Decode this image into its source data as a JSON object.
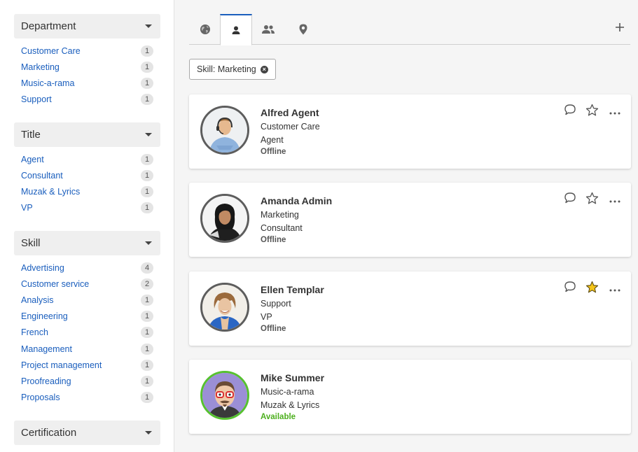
{
  "sidebar": {
    "facets": [
      {
        "title": "Department",
        "items": [
          {
            "label": "Customer Care",
            "count": "1"
          },
          {
            "label": "Marketing",
            "count": "1"
          },
          {
            "label": "Music-a-rama",
            "count": "1"
          },
          {
            "label": "Support",
            "count": "1"
          }
        ]
      },
      {
        "title": "Title",
        "items": [
          {
            "label": "Agent",
            "count": "1"
          },
          {
            "label": "Consultant",
            "count": "1"
          },
          {
            "label": "Muzak & Lyrics",
            "count": "1"
          },
          {
            "label": "VP",
            "count": "1"
          }
        ]
      },
      {
        "title": "Skill",
        "items": [
          {
            "label": "Advertising",
            "count": "4"
          },
          {
            "label": "Customer service",
            "count": "2"
          },
          {
            "label": "Analysis",
            "count": "1"
          },
          {
            "label": "Engineering",
            "count": "1"
          },
          {
            "label": "French",
            "count": "1"
          },
          {
            "label": "Management",
            "count": "1"
          },
          {
            "label": "Project management",
            "count": "1"
          },
          {
            "label": "Proofreading",
            "count": "1"
          },
          {
            "label": "Proposals",
            "count": "1"
          }
        ]
      },
      {
        "title": "Certification",
        "items": []
      }
    ]
  },
  "tabs": [
    {
      "icon": "globe-icon",
      "active": false
    },
    {
      "icon": "person-icon",
      "active": true
    },
    {
      "icon": "people-icon",
      "active": false
    },
    {
      "icon": "location-pin-icon",
      "active": false
    }
  ],
  "add_tab_icon": "plus-icon",
  "filter": {
    "label": "Skill: Marketing",
    "remove_icon": "close-circle-icon"
  },
  "people": [
    {
      "name": "Alfred Agent",
      "department": "Customer Care",
      "title": "Agent",
      "status": "Offline",
      "favorite": false
    },
    {
      "name": "Amanda Admin",
      "department": "Marketing",
      "title": "Consultant",
      "status": "Offline",
      "favorite": false
    },
    {
      "name": "Ellen Templar",
      "department": "Support",
      "title": "VP",
      "status": "Offline",
      "favorite": true
    },
    {
      "name": "Mike Summer",
      "department": "Music-a-rama",
      "title": "Muzak & Lyrics",
      "status": "Available",
      "favorite": false
    }
  ],
  "colors": {
    "link": "#1a5ebd",
    "accent": "#1a5ebd",
    "available": "#4caf1d",
    "star_favorite": "#f5c518"
  }
}
